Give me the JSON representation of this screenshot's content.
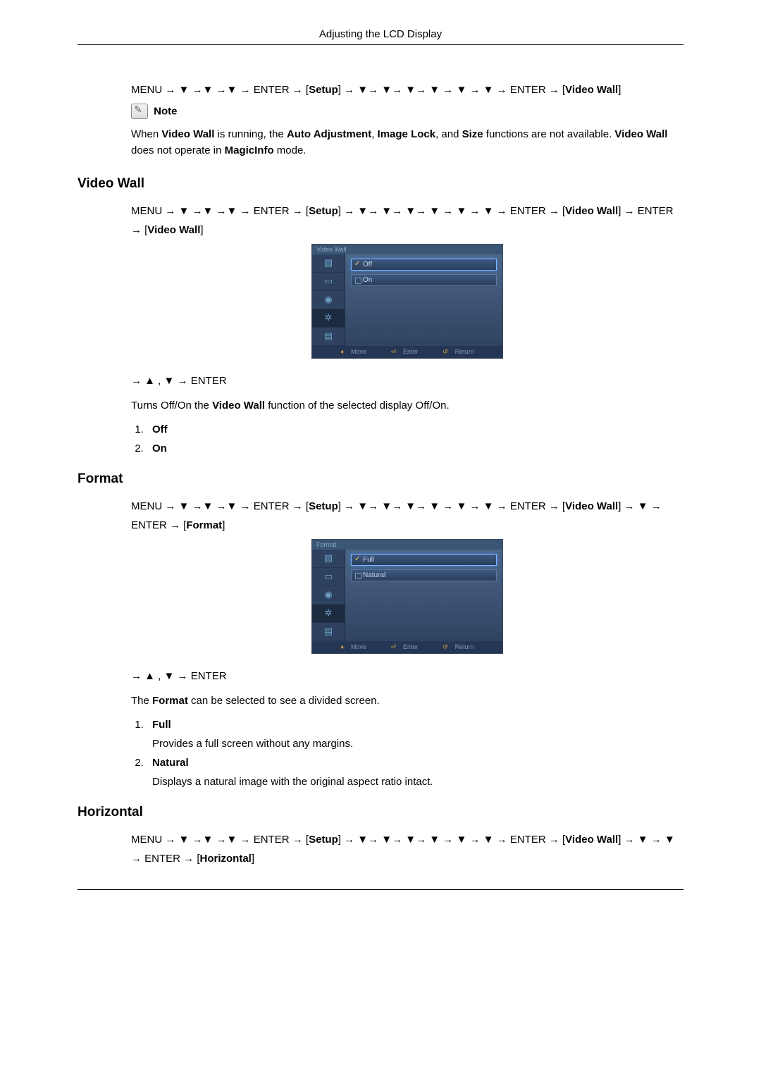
{
  "header": {
    "title": "Adjusting the LCD Display"
  },
  "intro": {
    "nav_prefix": "MENU → ▼ →▼ →▼ → ENTER → [",
    "nav_setup": "Setup",
    "nav_mid": "] → ▼→ ▼→ ▼→ ▼ → ▼ → ▼ → ENTER → [",
    "nav_vw": "Video Wall",
    "nav_end": "]",
    "note_label": "Note",
    "note_l1a": "When ",
    "note_l1b": "Video Wall",
    "note_l1c": " is running, the ",
    "note_l1d": "Auto Adjustment",
    "note_l1e": ", ",
    "note_l1f": "Image Lock",
    "note_l1g": ", and ",
    "note_l1h": "Size",
    "note_l1i": " functions are not available. ",
    "note_l2a": "Video Wall",
    "note_l2b": " does not operate in ",
    "note_l2c": "MagicInfo",
    "note_l2d": " mode."
  },
  "section_vw": {
    "heading": "Video Wall",
    "nav_a": "MENU → ▼ →▼ →▼ → ENTER → [",
    "nav_setup": "Setup",
    "nav_b": "] → ▼→ ▼→ ▼→ ▼ → ▼ → ▼ → ENTER → [",
    "nav_vw": "Video Wall",
    "nav_c": "] → ENTER → [",
    "nav_vw2": "Video Wall",
    "nav_d": "]",
    "osd_title": "Video Wall",
    "opt1": "Off",
    "opt2": "On",
    "foot_move": "Move",
    "foot_enter": "Enter",
    "foot_return": "Return",
    "post_nav": "→ ▲ , ▼ → ENTER",
    "desc_a": "Turns Off/On the ",
    "desc_b": "Video Wall",
    "desc_c": " function of the selected display Off/On.",
    "li1": "Off",
    "li2": "On"
  },
  "section_fmt": {
    "heading": "Format",
    "nav_a": "MENU → ▼ →▼ →▼ → ENTER → [",
    "nav_setup": "Setup",
    "nav_b": "] → ▼→ ▼→ ▼→ ▼ → ▼ → ▼ → ENTER → [",
    "nav_vw": "Video Wall",
    "nav_c": "] → ▼ → ENTER → [",
    "nav_fmt": "Format",
    "nav_d": "]",
    "osd_title": "Format",
    "opt1": "Full",
    "opt2": "Natural",
    "foot_move": "Move",
    "foot_enter": "Enter",
    "foot_return": "Return",
    "post_nav": "→ ▲ , ▼ → ENTER",
    "desc_a": "The ",
    "desc_b": "Format",
    "desc_c": " can be selected to see a divided screen.",
    "li1": "Full",
    "li1_desc": "Provides a full screen without any margins.",
    "li2": "Natural",
    "li2_desc": "Displays a natural image with the original aspect ratio intact."
  },
  "section_hz": {
    "heading": "Horizontal",
    "nav_a": "MENU → ▼ →▼ →▼ → ENTER → [",
    "nav_setup": "Setup",
    "nav_b": "] → ▼→ ▼→ ▼→ ▼ → ▼ → ▼ → ENTER → [",
    "nav_vw": "Video Wall",
    "nav_c": "] → ▼ → ▼ → ENTER → [",
    "nav_hz": "Horizontal",
    "nav_d": "]"
  }
}
